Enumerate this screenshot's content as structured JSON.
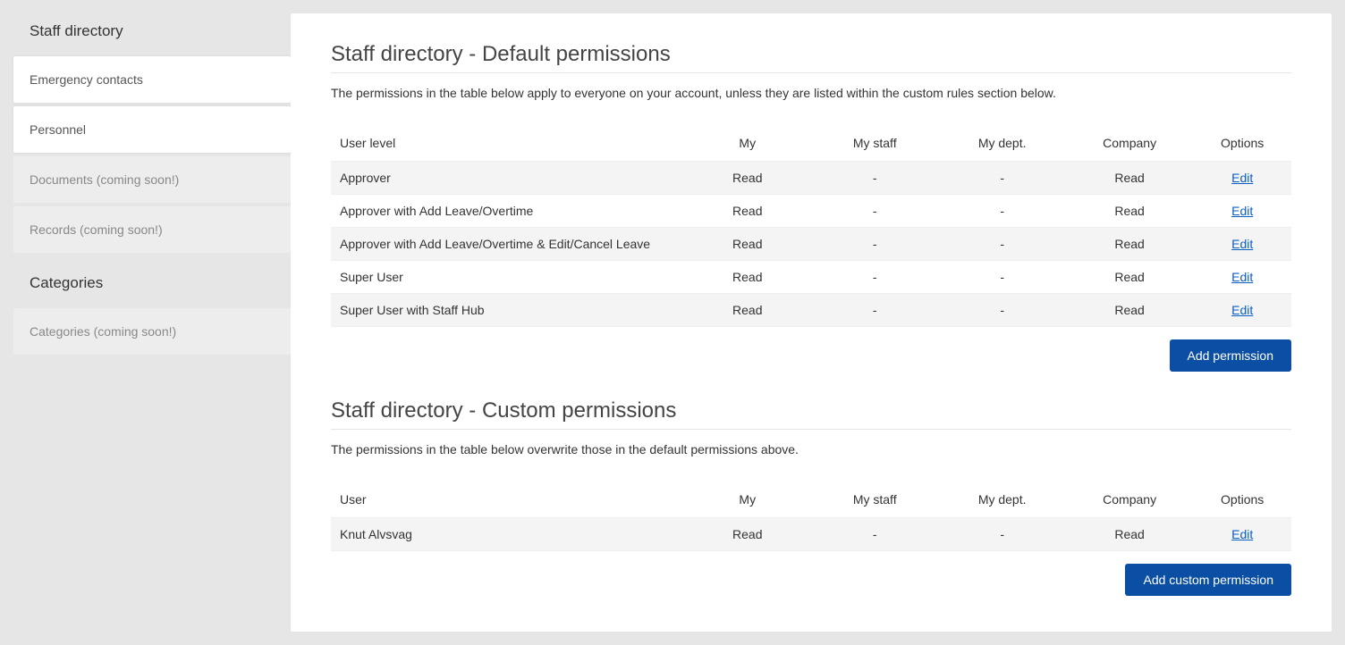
{
  "sidebar": {
    "heading1": "Staff directory",
    "items": [
      {
        "label": "Emergency contacts",
        "active": true
      },
      {
        "label": "Personnel",
        "active": true
      },
      {
        "label": "Documents (coming soon!)",
        "active": false
      },
      {
        "label": "Records (coming soon!)",
        "active": false
      }
    ],
    "heading2": "Categories",
    "items2": [
      {
        "label": "Categories (coming soon!)",
        "active": false
      }
    ]
  },
  "default_section": {
    "title": "Staff directory - Default permissions",
    "desc": "The permissions in the table below apply to everyone on your account, unless they are listed within the custom rules section below.",
    "headers": {
      "c0": "User level",
      "c1": "My",
      "c2": "My staff",
      "c3": "My dept.",
      "c4": "Company",
      "c5": "Options"
    },
    "rows": [
      {
        "c0": "Approver",
        "c1": "Read",
        "c2": "-",
        "c3": "-",
        "c4": "Read",
        "c5": "Edit"
      },
      {
        "c0": "Approver with Add Leave/Overtime",
        "c1": "Read",
        "c2": "-",
        "c3": "-",
        "c4": "Read",
        "c5": "Edit"
      },
      {
        "c0": "Approver with Add Leave/Overtime & Edit/Cancel Leave",
        "c1": "Read",
        "c2": "-",
        "c3": "-",
        "c4": "Read",
        "c5": "Edit"
      },
      {
        "c0": "Super User",
        "c1": "Read",
        "c2": "-",
        "c3": "-",
        "c4": "Read",
        "c5": "Edit"
      },
      {
        "c0": "Super User with Staff Hub",
        "c1": "Read",
        "c2": "-",
        "c3": "-",
        "c4": "Read",
        "c5": "Edit"
      }
    ],
    "button": "Add permission"
  },
  "custom_section": {
    "title": "Staff directory - Custom permissions",
    "desc": "The permissions in the table below overwrite those in the default permissions above.",
    "headers": {
      "c0": "User",
      "c1": "My",
      "c2": "My staff",
      "c3": "My dept.",
      "c4": "Company",
      "c5": "Options"
    },
    "rows": [
      {
        "c0": "Knut Alvsvag",
        "c1": "Read",
        "c2": "-",
        "c3": "-",
        "c4": "Read",
        "c5": "Edit"
      }
    ],
    "button": "Add custom permission"
  }
}
